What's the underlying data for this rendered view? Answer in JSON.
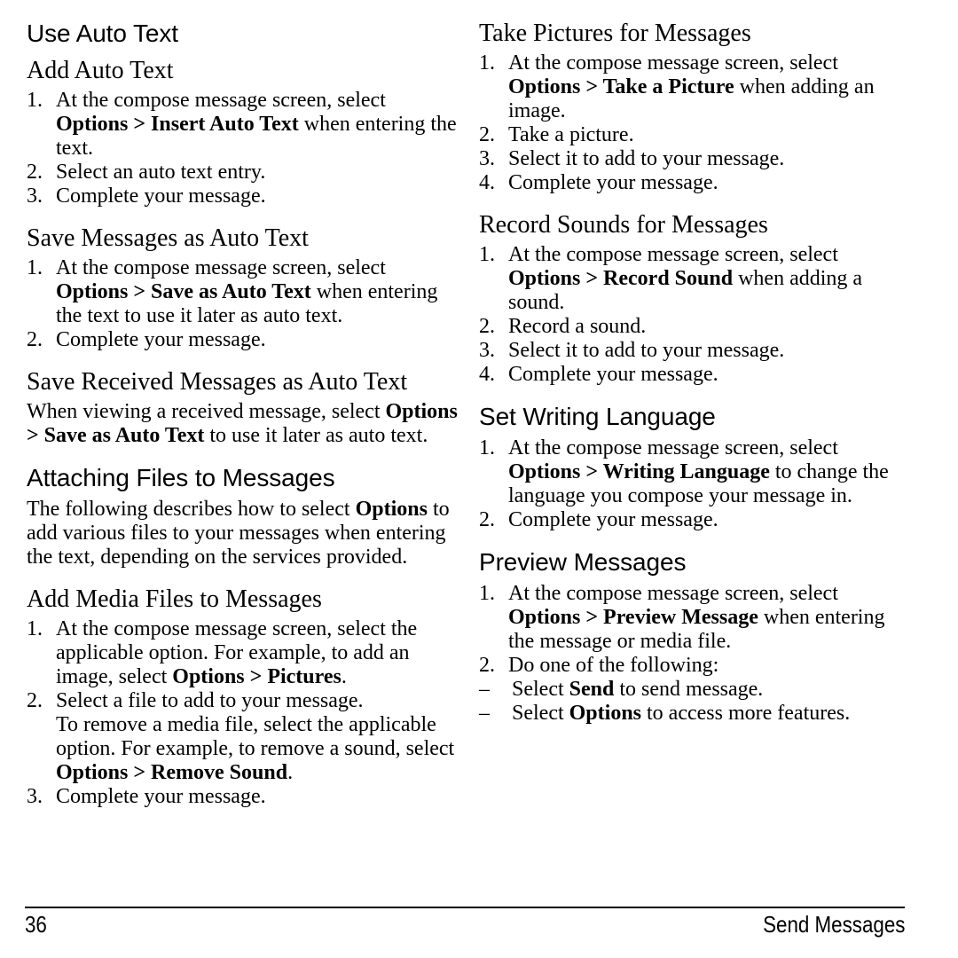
{
  "document": {
    "page_number": "36",
    "running_footer": "Send Messages"
  },
  "left_column": {
    "section_use_auto_text": {
      "heading": "Use Auto Text"
    },
    "section_add_auto_text": {
      "heading": "Add Auto Text",
      "steps": [
        {
          "num": "1.",
          "text_before": "At the compose message screen, select ",
          "bold": "Options > Insert Auto Text",
          "text_after": " when entering the text."
        },
        {
          "num": "2.",
          "text_before": "Select an auto text entry.",
          "bold": "",
          "text_after": ""
        },
        {
          "num": "3.",
          "text_before": "Complete your message.",
          "bold": "",
          "text_after": ""
        }
      ]
    },
    "section_save_messages_as_auto_text": {
      "heading": "Save Messages as Auto Text",
      "steps": [
        {
          "num": "1.",
          "text_before": "At the compose message screen, select ",
          "bold": "Options > Save as Auto Text",
          "text_after": " when entering the text to use it later as auto text."
        },
        {
          "num": "2.",
          "text_before": "Complete your message.",
          "bold": "",
          "text_after": ""
        }
      ]
    },
    "section_save_received_messages_as_auto_text": {
      "heading": "Save Received Messages as Auto Text",
      "paragraph": {
        "text_before": "When viewing a received message, select ",
        "bold": "Options > Save as Auto Text",
        "text_after": " to use it later as auto text."
      }
    },
    "section_attaching_files_to_messages": {
      "heading": "Attaching Files to Messages",
      "paragraph": {
        "text_before": "The following describes how to select ",
        "bold": "Options",
        "text_after": " to add various files to your messages when entering the text, depending on the services provided."
      }
    },
    "section_add_media_files_to_messages": {
      "heading": "Add Media Files to Messages",
      "steps": [
        {
          "num": "1.",
          "text_before": "At the compose message screen, select the applicable option. For example, to add an image, select ",
          "bold": "Options > Pictures",
          "text_after": "."
        },
        {
          "num": "2.",
          "text_before": "Select a file to add to your message.",
          "bold": "",
          "text_after": "",
          "substep_before": "To remove a media file, select the applicable option. For example, to remove a sound, select ",
          "substep_bold": "Options > Remove Sound",
          "substep_after": "."
        },
        {
          "num": "3.",
          "text_before": "Complete your message.",
          "bold": "",
          "text_after": ""
        }
      ]
    }
  },
  "right_column": {
    "section_take_pictures_for_messages": {
      "heading": "Take Pictures for Messages",
      "steps": [
        {
          "num": "1.",
          "text_before": "At the compose message screen, select ",
          "bold": "Options > Take a Picture",
          "text_after": " when adding an image."
        },
        {
          "num": "2.",
          "text_before": "Take a picture.",
          "bold": "",
          "text_after": ""
        },
        {
          "num": "3.",
          "text_before": "Select it to add to your message.",
          "bold": "",
          "text_after": ""
        },
        {
          "num": "4.",
          "text_before": "Complete your message.",
          "bold": "",
          "text_after": ""
        }
      ]
    },
    "section_record_sounds_for_messages": {
      "heading": "Record Sounds for Messages",
      "steps": [
        {
          "num": "1.",
          "text_before": "At the compose message screen, select ",
          "bold": "Options > Record Sound",
          "text_after": " when adding a sound."
        },
        {
          "num": "2.",
          "text_before": "Record a sound.",
          "bold": "",
          "text_after": ""
        },
        {
          "num": "3.",
          "text_before": "Select it to add to your message.",
          "bold": "",
          "text_after": ""
        },
        {
          "num": "4.",
          "text_before": "Complete your message.",
          "bold": "",
          "text_after": ""
        }
      ]
    },
    "section_set_writing_language": {
      "heading": "Set Writing Language",
      "steps": [
        {
          "num": "1.",
          "text_before": "At the compose message screen, select ",
          "bold": "Options > Writing Language",
          "text_after": " to change the language you compose your message in."
        },
        {
          "num": "2.",
          "text_before": "Complete your message.",
          "bold": "",
          "text_after": ""
        }
      ]
    },
    "section_preview_messages": {
      "heading": "Preview Messages",
      "steps": [
        {
          "num": "1.",
          "text_before": "At the compose message screen, select ",
          "bold": "Options > Preview Message",
          "text_after": " when entering the message or media file."
        },
        {
          "num": "2.",
          "text_before": "Do one of the following:",
          "bold": "",
          "text_after": ""
        }
      ],
      "dash_items": [
        {
          "dash": "–",
          "text_before": "Select ",
          "bold": "Send",
          "text_after": " to send message."
        },
        {
          "dash": "–",
          "text_before": "Select ",
          "bold": "Options",
          "text_after": " to access more features."
        }
      ]
    }
  }
}
